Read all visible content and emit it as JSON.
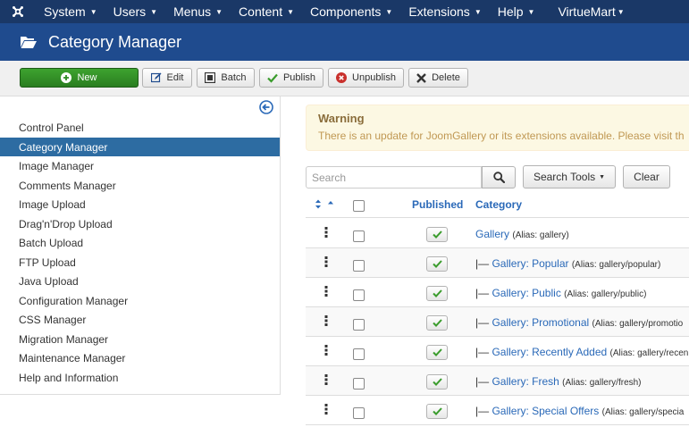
{
  "topnav": {
    "items": [
      {
        "label": "System"
      },
      {
        "label": "Users"
      },
      {
        "label": "Menus"
      },
      {
        "label": "Content"
      },
      {
        "label": "Components"
      },
      {
        "label": "Extensions"
      },
      {
        "label": "Help"
      }
    ],
    "virtuemart_label": "VirtueMart"
  },
  "header": {
    "title": "Category Manager"
  },
  "toolbar": {
    "new_label": "New",
    "edit_label": "Edit",
    "batch_label": "Batch",
    "publish_label": "Publish",
    "unpublish_label": "Unpublish",
    "delete_label": "Delete"
  },
  "sidebar": {
    "items": [
      {
        "label": "Control Panel"
      },
      {
        "label": "Category Manager"
      },
      {
        "label": "Image Manager"
      },
      {
        "label": "Comments Manager"
      },
      {
        "label": "Image Upload"
      },
      {
        "label": "Drag'n'Drop Upload"
      },
      {
        "label": "Batch Upload"
      },
      {
        "label": "FTP Upload"
      },
      {
        "label": "Java Upload"
      },
      {
        "label": "Configuration Manager"
      },
      {
        "label": "CSS Manager"
      },
      {
        "label": "Migration Manager"
      },
      {
        "label": "Maintenance Manager"
      },
      {
        "label": "Help and Information"
      }
    ],
    "active_index": 1
  },
  "warning": {
    "title": "Warning",
    "text": "There is an update for JoomGallery or its extensions available. Please visit th"
  },
  "search": {
    "placeholder": "Search",
    "search_tools_label": "Search Tools",
    "clear_label": "Clear"
  },
  "table": {
    "published_header": "Published",
    "category_header": "Category",
    "rows": [
      {
        "prefix": "",
        "name": "Gallery",
        "alias": "(Alias: gallery)"
      },
      {
        "prefix": "|— ",
        "name": "Gallery: Popular",
        "alias": "(Alias: gallery/popular)"
      },
      {
        "prefix": "|— ",
        "name": "Gallery: Public",
        "alias": "(Alias: gallery/public)"
      },
      {
        "prefix": "|— ",
        "name": "Gallery: Promotional",
        "alias": "(Alias: gallery/promotio"
      },
      {
        "prefix": "|— ",
        "name": "Gallery: Recently Added",
        "alias": "(Alias: gallery/recen"
      },
      {
        "prefix": "|— ",
        "name": "Gallery: Fresh",
        "alias": "(Alias: gallery/fresh)"
      },
      {
        "prefix": "|— ",
        "name": "Gallery: Special Offers",
        "alias": "(Alias: gallery/specia"
      }
    ]
  },
  "colors": {
    "topnav_bg": "#1a3867",
    "header_bg": "#1f4b8e",
    "new_button": "#2f8c23",
    "active_sidebar": "#2d6ca2",
    "link": "#2a69b8",
    "published_check": "#3a9c2c"
  },
  "icons": {
    "logo": "joomla-logo-icon",
    "header": "folder-open-icon",
    "new": "plus-circle-icon",
    "edit": "edit-icon",
    "batch": "batch-icon",
    "publish": "check-icon",
    "unpublish": "x-circle-icon",
    "delete": "x-icon",
    "collapse": "circle-arrow-left-icon",
    "search": "search-icon",
    "drag": "drag-handle-icon"
  }
}
